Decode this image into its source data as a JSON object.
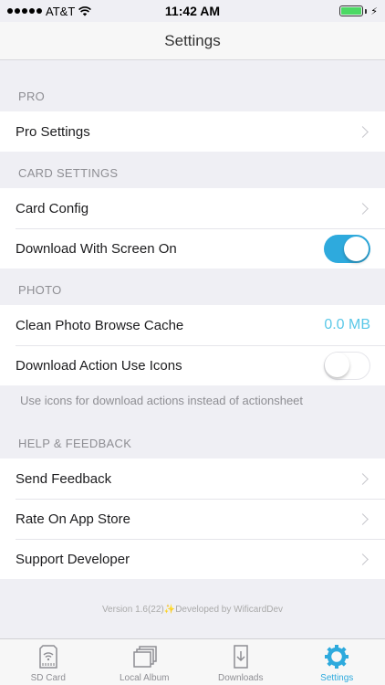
{
  "status": {
    "carrier": "AT&T",
    "time": "11:42 AM"
  },
  "nav": {
    "title": "Settings"
  },
  "sections": {
    "pro": {
      "header": "PRO",
      "items": [
        {
          "label": "Pro Settings"
        }
      ]
    },
    "card": {
      "header": "CARD SETTINGS",
      "items": [
        {
          "label": "Card Config"
        },
        {
          "label": "Download With Screen On",
          "toggle": true
        }
      ]
    },
    "photo": {
      "header": "PHOTO",
      "items": [
        {
          "label": "Clean Photo Browse Cache",
          "value": "0.0 MB"
        },
        {
          "label": "Download Action Use Icons",
          "toggle": false
        }
      ],
      "footer": "Use icons for download actions instead of actionsheet"
    },
    "help": {
      "header": "HELP & FEEDBACK",
      "items": [
        {
          "label": "Send Feedback"
        },
        {
          "label": "Rate On App Store"
        },
        {
          "label": "Support Developer"
        }
      ]
    }
  },
  "version_text": "Version 1.6(22)✨Developed by WificardDev",
  "tabs": [
    {
      "label": "SD Card",
      "icon": "sd-card-icon",
      "active": false
    },
    {
      "label": "Local Album",
      "icon": "album-stack-icon",
      "active": false
    },
    {
      "label": "Downloads",
      "icon": "download-tray-icon",
      "active": false
    },
    {
      "label": "Settings",
      "icon": "gear-icon",
      "active": true
    }
  ],
  "colors": {
    "accent": "#2eaadd",
    "value": "#5ac8e8",
    "background": "#efeff4"
  }
}
